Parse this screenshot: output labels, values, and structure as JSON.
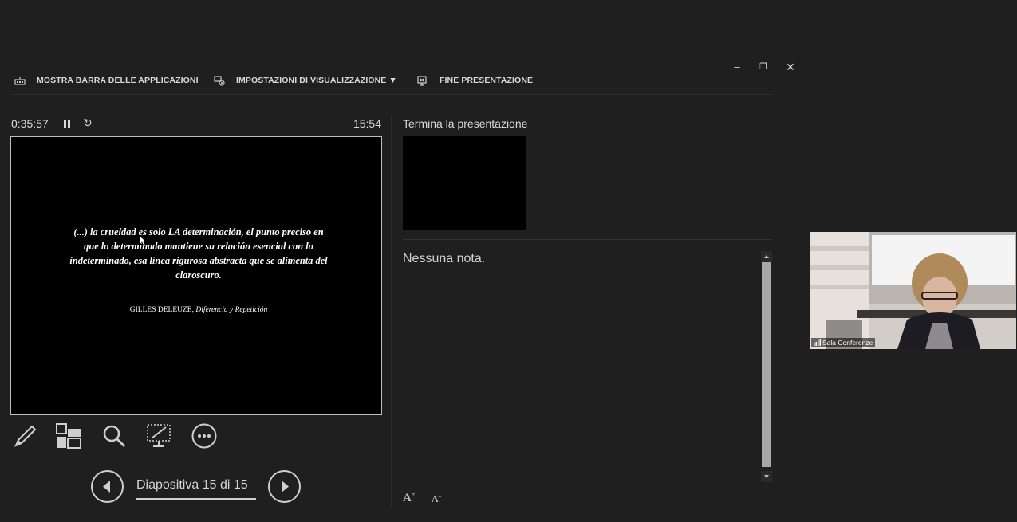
{
  "window": {
    "minimize": "–",
    "restore": "❐",
    "close": "✕"
  },
  "toolbar": {
    "taskbar_label": "MOSTRA BARRA DELLE APPLICAZIONI",
    "display_label": "IMPOSTAZIONI DI VISUALIZZAZIONE ▼",
    "end_label": "FINE PRESENTAZIONE"
  },
  "timer": {
    "elapsed": "0:35:57",
    "clock": "15:54",
    "reset": "↻"
  },
  "slide": {
    "quote": "(...) la crueldad es solo LA determinación, el punto preciso en que lo determinado mantiene su relación esencial con lo indeterminado, esa línea rigurosa abstracta que se alimenta del claroscuro.",
    "author": "GILLES DELEUZE,",
    "work": "Diferencia y Repetición"
  },
  "next_slide": {
    "title": "Termina la presentazione"
  },
  "notes": {
    "text": "Nessuna nota."
  },
  "navigation": {
    "counter": "Diapositiva 15 di 15",
    "current": 15,
    "total": 15
  },
  "font_controls": {
    "increase": "A",
    "decrease": "A"
  },
  "webcam": {
    "label": "Sala Conferenze"
  },
  "icons": {
    "tools": [
      "pen-icon",
      "grid-icon",
      "zoom-icon",
      "screen-icon",
      "more-icon"
    ],
    "toolbar": [
      "taskbar-icon",
      "display-settings-icon",
      "end-presentation-icon"
    ]
  },
  "colors": {
    "background": "#1f1f1f",
    "slide": "#000000",
    "text": "#dcdcdc",
    "scroll_thumb": "#a8a8a8"
  }
}
